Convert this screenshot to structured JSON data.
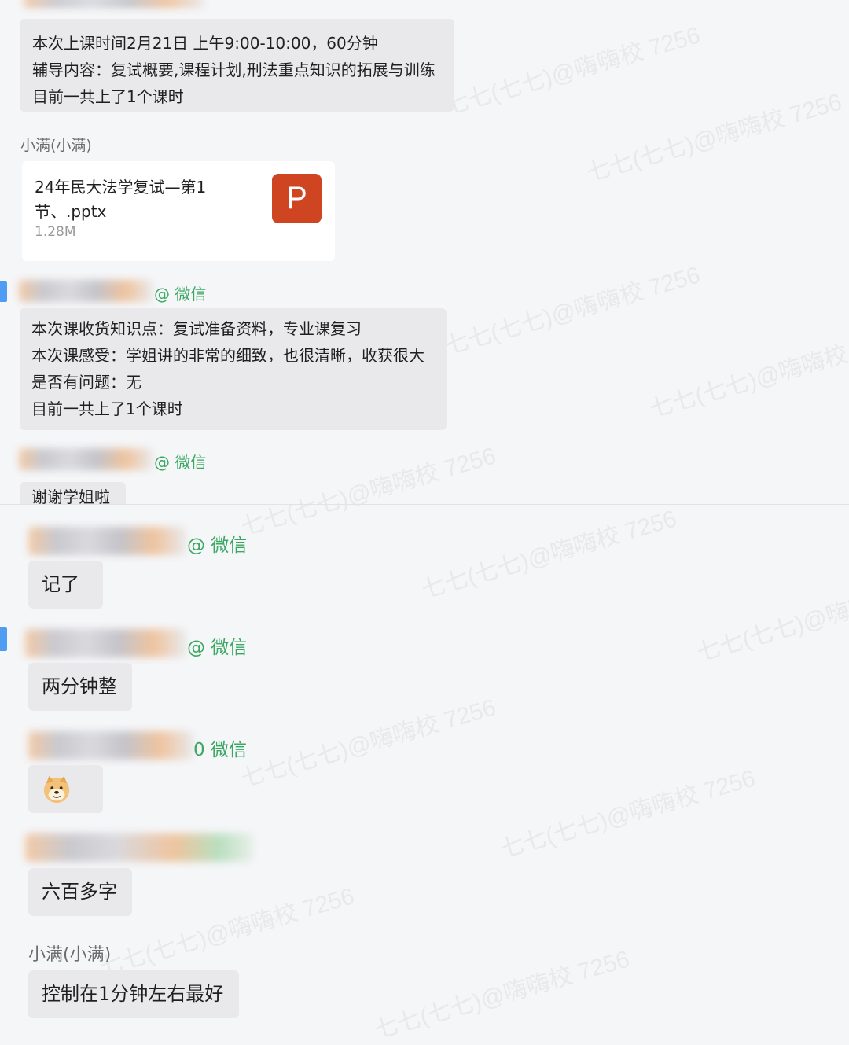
{
  "messages": {
    "m1": {
      "lines": [
        "本次上课时间2月21日 上午9:00-10:00，60分钟",
        "辅导内容：复试概要,课程计划,刑法重点知识的拓展与训练",
        "目前一共上了1个课时"
      ]
    },
    "m2": {
      "sender": "小满(小满)",
      "file": {
        "name": "24年民大法学复试—第1节、.pptx",
        "size": "1.28M",
        "icon_letter": "P"
      }
    },
    "m3": {
      "wechat_tag": "@ 微信",
      "lines": [
        "本次课收货知识点：复试准备资料，专业课复习",
        "本次课感受：学姐讲的非常的细致，也很清晰，收获很大",
        "是否有问题：无",
        "目前一共上了1个课时"
      ]
    },
    "m4": {
      "wechat_tag": "@ 微信",
      "text": "谢谢学姐啦"
    },
    "m5": {
      "wechat_tag": "@ 微信",
      "text": "记了"
    },
    "m6": {
      "wechat_tag": "@ 微信",
      "text": "两分钟整"
    },
    "m7": {
      "wechat_tag": "0 微信",
      "emoji": "doge-emoji"
    },
    "m8": {
      "text": "六百多字"
    },
    "m9": {
      "sender": "小满(小满)",
      "text": "控制在1分钟左右最好"
    }
  },
  "watermark": "七七(七七)@嗨嗨校 7256",
  "colors": {
    "bubble": "#e9e9eb",
    "wechat_green": "#3aa862",
    "ppt_orange": "#cf4521",
    "background": "#f5f6f8"
  }
}
